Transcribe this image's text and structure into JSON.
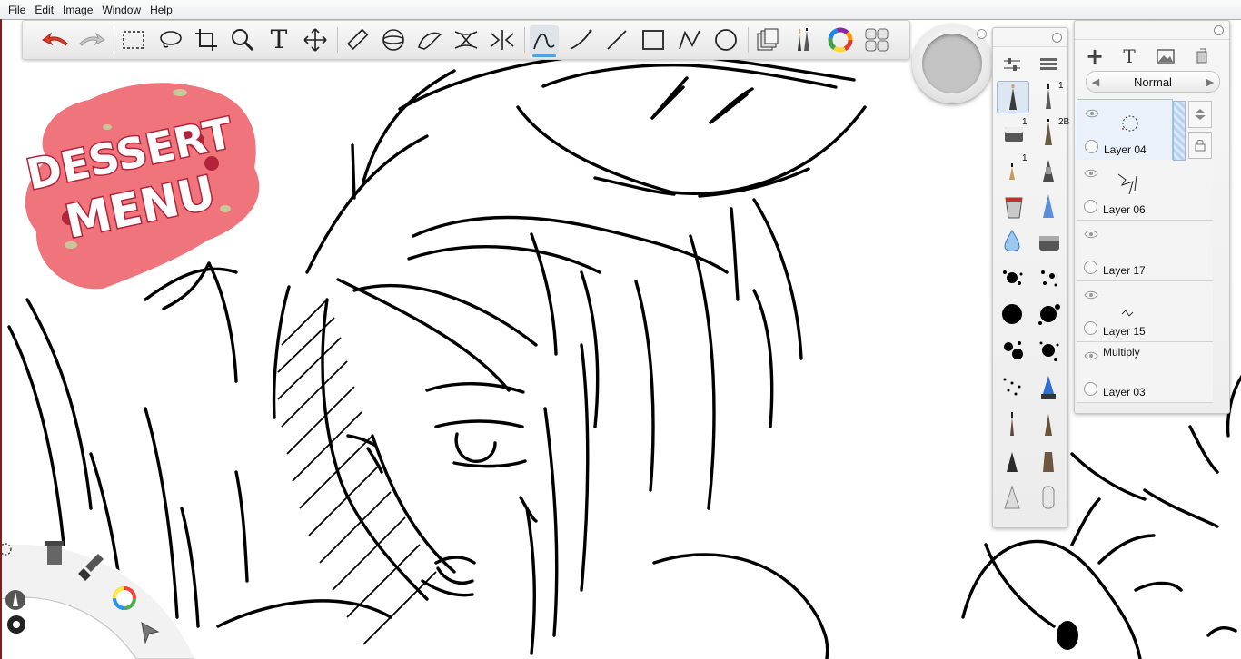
{
  "menu": [
    "File",
    "Edit",
    "Image",
    "Window",
    "Help"
  ],
  "toolbar": {
    "tools": [
      {
        "icon": "undo-arrow-icon",
        "name": "undo-button"
      },
      {
        "icon": "redo-arrow-icon",
        "name": "redo-button"
      },
      {
        "icon": "rect-select-icon",
        "name": "rectangle-select-tool"
      },
      {
        "icon": "lasso-icon",
        "name": "lasso-tool"
      },
      {
        "icon": "crop-icon",
        "name": "crop-tool"
      },
      {
        "icon": "magnifier-icon",
        "name": "zoom-tool"
      },
      {
        "icon": "text-icon",
        "name": "text-tool",
        "glyph": "T"
      },
      {
        "icon": "move-icon",
        "name": "transform-tool"
      },
      {
        "icon": "ruler-icon",
        "name": "ruler-tool"
      },
      {
        "icon": "ellipse-guide-icon",
        "name": "ellipse-guide-tool"
      },
      {
        "icon": "french-curve-icon",
        "name": "french-curve-tool"
      },
      {
        "icon": "symmetry-icon",
        "name": "symmetry-tool"
      },
      {
        "icon": "perspective-icon",
        "name": "perspective-tool"
      },
      {
        "icon": "steady-stroke-icon",
        "name": "steady-stroke-tool"
      },
      {
        "icon": "curve-icon",
        "name": "curve-tool"
      },
      {
        "icon": "line-icon",
        "name": "line-tool"
      },
      {
        "icon": "rectangle-icon",
        "name": "rectangle-tool"
      },
      {
        "icon": "polyline-icon",
        "name": "polyline-tool"
      },
      {
        "icon": "ellipse-icon",
        "name": "ellipse-tool"
      },
      {
        "icon": "layers-copy-icon",
        "name": "layers-button"
      },
      {
        "icon": "brushes-icon",
        "name": "brushes-button"
      },
      {
        "icon": "color-wheel-icon",
        "name": "color-wheel-button"
      },
      {
        "icon": "copic-grid-icon",
        "name": "copic-library-button"
      }
    ],
    "active_tool": "steady-stroke-tool"
  },
  "brush_panel": {
    "header_icons": [
      "sliders-icon",
      "brush-list-icon"
    ],
    "brushes": [
      {
        "icon": "pencil-brush-icon",
        "col": 0,
        "label": ""
      },
      {
        "icon": "pencil-2b-icon",
        "col": 1,
        "label": "1"
      },
      {
        "icon": "eraser-icon",
        "col": 0,
        "label": "1"
      },
      {
        "icon": "pencil-sharp-icon",
        "col": 1,
        "label": "2B"
      },
      {
        "icon": "small-nib-icon",
        "col": 0,
        "label": "1"
      },
      {
        "icon": "ink-pen-icon",
        "col": 1,
        "label": ""
      },
      {
        "icon": "paint-bucket-icon",
        "col": 0,
        "label": ""
      },
      {
        "icon": "chisel-marker-icon",
        "col": 1,
        "label": ""
      },
      {
        "icon": "water-drop-icon",
        "col": 0,
        "label": ""
      },
      {
        "icon": "airbrush-icon",
        "col": 1,
        "label": ""
      },
      {
        "icon": "splatter-small-icon",
        "col": 0,
        "label": ""
      },
      {
        "icon": "speckle-icon",
        "col": 1,
        "label": ""
      },
      {
        "icon": "splatter-big-icon",
        "col": 0,
        "label": ""
      },
      {
        "icon": "splatter-blob-icon",
        "col": 1,
        "label": ""
      },
      {
        "icon": "splatter-cluster-icon",
        "col": 0,
        "label": ""
      },
      {
        "icon": "splatter-spray-icon",
        "col": 1,
        "label": ""
      },
      {
        "icon": "dots-icon",
        "col": 0,
        "label": ""
      },
      {
        "icon": "blue-marker-icon",
        "col": 1,
        "label": ""
      },
      {
        "icon": "fine-brush-icon",
        "col": 0,
        "label": ""
      },
      {
        "icon": "bristle-brush-icon",
        "col": 1,
        "label": ""
      },
      {
        "icon": "dark-brush-icon",
        "col": 0,
        "label": ""
      },
      {
        "icon": "flat-brush-icon",
        "col": 1,
        "label": ""
      },
      {
        "icon": "fan-brush-icon",
        "col": 0,
        "label": ""
      },
      {
        "icon": "blender-icon",
        "col": 1,
        "label": ""
      }
    ]
  },
  "layer_panel": {
    "tools": [
      "add-layer-icon",
      "text-layer-icon",
      "image-layer-icon",
      "clear-layer-icon"
    ],
    "text_tool_glyph": "T",
    "add_glyph": "+",
    "blend_mode": "Normal",
    "blend_prev": "◀",
    "blend_next": "▶",
    "layers": [
      {
        "name": "Layer 04",
        "mode": "",
        "selected": true
      },
      {
        "name": "Layer 06",
        "mode": "",
        "selected": false
      },
      {
        "name": "Layer 17",
        "mode": "",
        "selected": false
      },
      {
        "name": "Layer 15",
        "mode": "",
        "selected": false
      },
      {
        "name": "Layer 03",
        "mode": "Multiply",
        "selected": false
      }
    ]
  },
  "canvas": {
    "logo_lines": [
      "DESSERT",
      "MENU"
    ],
    "logo_colors": {
      "blob": "#f0747c",
      "letters": "#ffffff",
      "outline": "#b3243a",
      "accent": "#c9c79a"
    }
  },
  "puck": {
    "current_color": "#c3c3c3"
  },
  "lagoon": {
    "icons": [
      "settings-icon",
      "tools-icon",
      "brush-icon",
      "color-wheel-icon",
      "pencil-icon",
      "select-arrow-icon"
    ]
  }
}
